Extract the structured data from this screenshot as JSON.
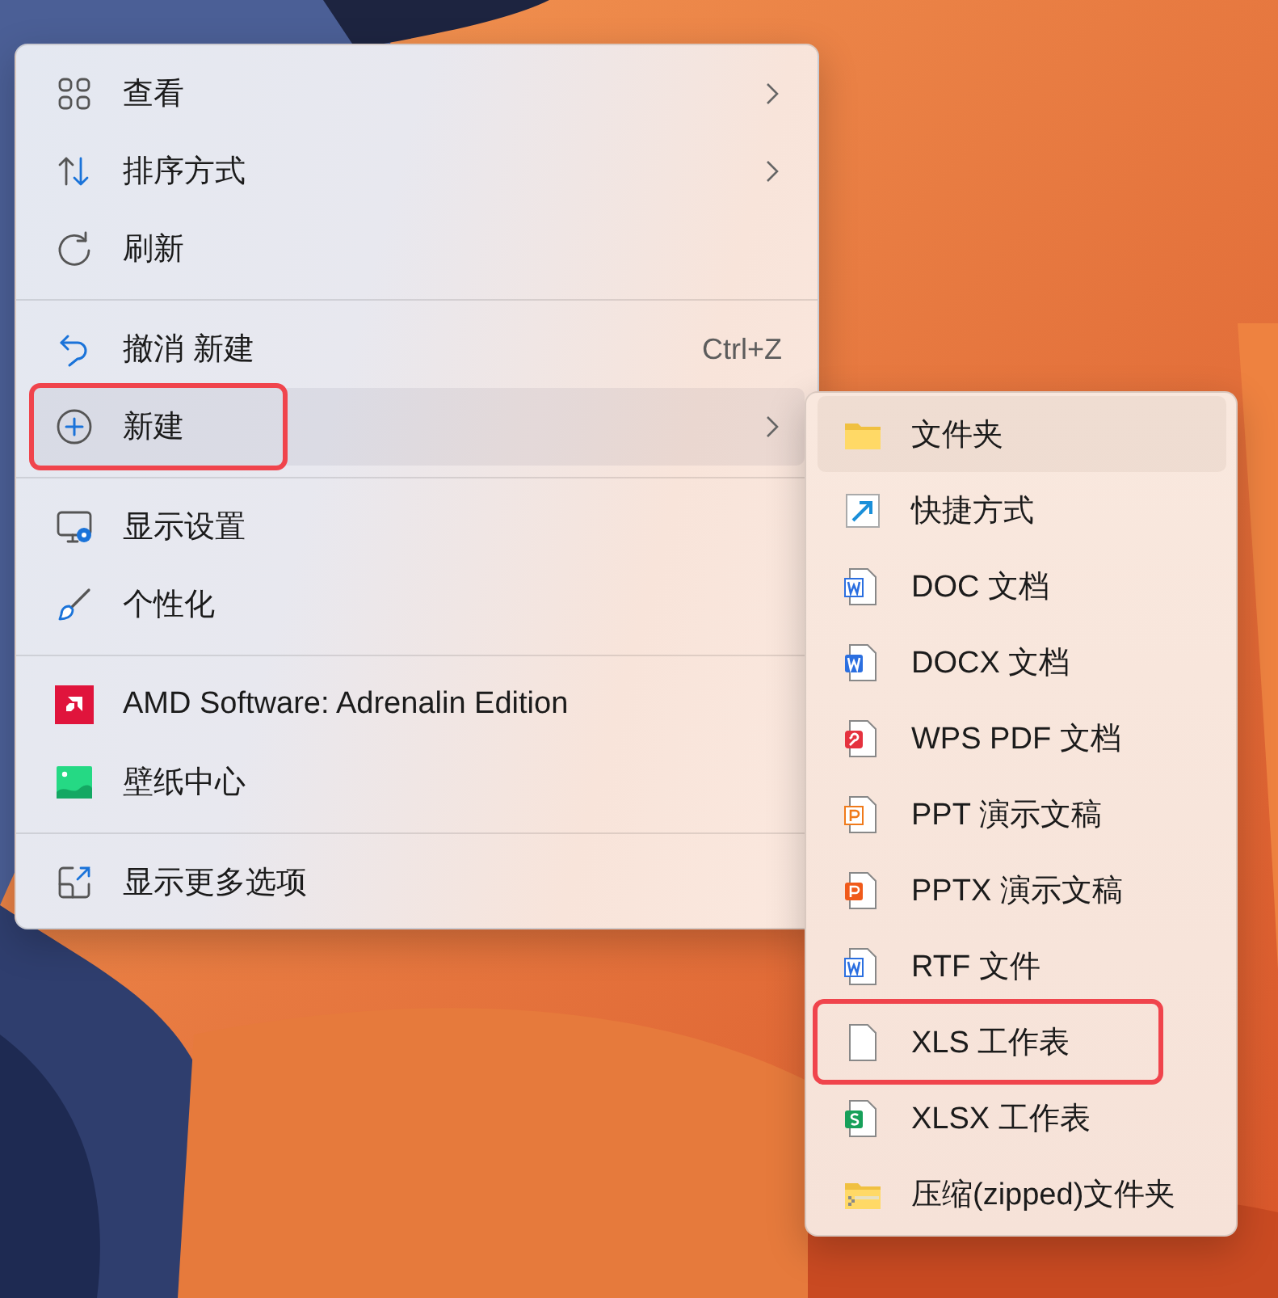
{
  "context_menu": {
    "groups": [
      [
        {
          "label": "查看",
          "submenu": true,
          "selected": false,
          "annotated": false
        },
        {
          "label": "排序方式",
          "submenu": true,
          "selected": false,
          "annotated": false
        },
        {
          "label": "刷新",
          "submenu": false,
          "selected": false,
          "annotated": false
        }
      ],
      [
        {
          "label": "撤消 新建",
          "shortcut": "Ctrl+Z",
          "submenu": false,
          "selected": false,
          "annotated": false
        },
        {
          "label": "新建",
          "submenu": true,
          "selected": true,
          "annotated": true
        }
      ],
      [
        {
          "label": "显示设置",
          "submenu": false,
          "selected": false,
          "annotated": false
        },
        {
          "label": "个性化",
          "submenu": false,
          "selected": false,
          "annotated": false
        }
      ],
      [
        {
          "label": "AMD Software: Adrenalin Edition",
          "submenu": false,
          "selected": false,
          "annotated": false
        },
        {
          "label": "壁纸中心",
          "submenu": false,
          "selected": false,
          "annotated": false
        }
      ],
      [
        {
          "label": "显示更多选项",
          "submenu": false,
          "selected": false,
          "annotated": false
        }
      ]
    ]
  },
  "submenu": {
    "items": [
      {
        "label": "文件夹",
        "selected": true,
        "annotated": false
      },
      {
        "label": "快捷方式",
        "selected": false,
        "annotated": false
      },
      {
        "label": "DOC 文档",
        "selected": false,
        "annotated": false
      },
      {
        "label": "DOCX 文档",
        "selected": false,
        "annotated": false
      },
      {
        "label": "WPS PDF 文档",
        "selected": false,
        "annotated": false
      },
      {
        "label": "PPT 演示文稿",
        "selected": false,
        "annotated": false
      },
      {
        "label": "PPTX 演示文稿",
        "selected": false,
        "annotated": false
      },
      {
        "label": "RTF 文件",
        "selected": false,
        "annotated": false
      },
      {
        "label": "XLS 工作表",
        "selected": false,
        "annotated": true
      },
      {
        "label": "XLSX 工作表",
        "selected": false,
        "annotated": false
      },
      {
        "label": "压缩(zipped)文件夹",
        "selected": false,
        "annotated": false
      }
    ]
  }
}
